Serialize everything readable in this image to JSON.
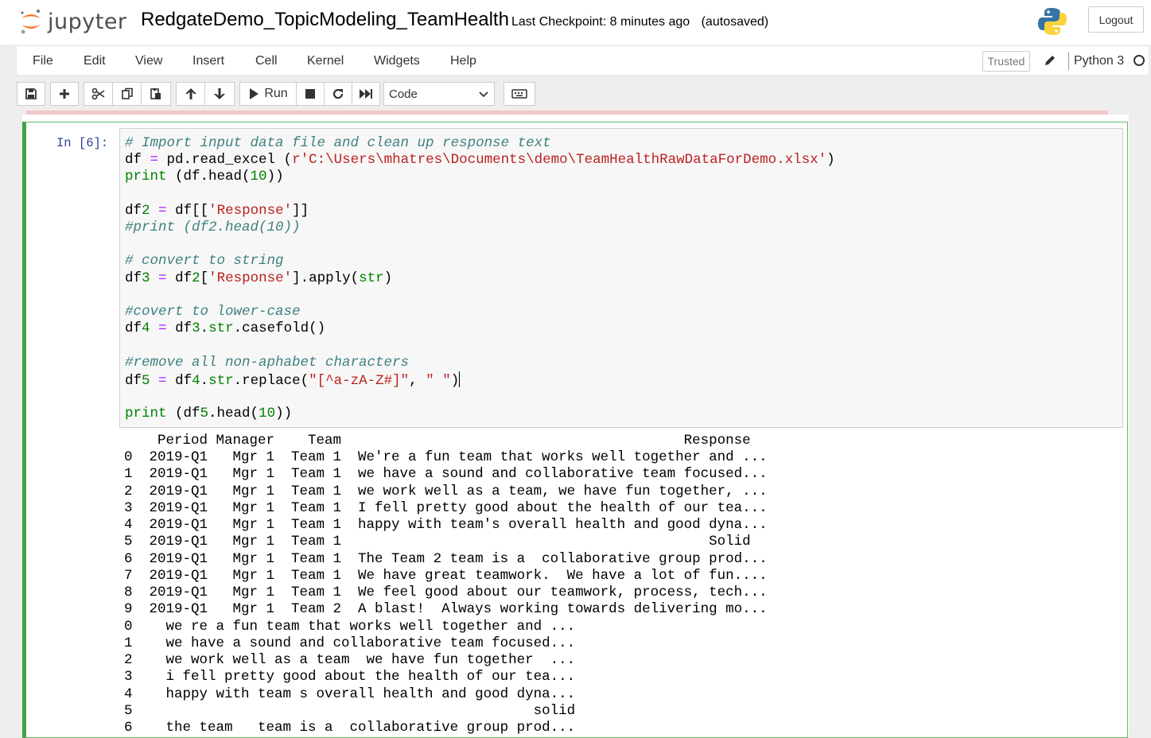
{
  "header": {
    "logo_text": "jupyter",
    "notebook_title": "RedgateDemo_TopicModeling_TeamHealth",
    "checkpoint": "Last Checkpoint: 8 minutes ago",
    "autosave_status": "(autosaved)",
    "logout_label": "Logout"
  },
  "menubar": {
    "items": [
      "File",
      "Edit",
      "View",
      "Insert",
      "Cell",
      "Kernel",
      "Widgets",
      "Help"
    ],
    "trusted_label": "Trusted",
    "kernel_name": "Python 3"
  },
  "toolbar": {
    "run_label": "Run",
    "cell_type": "Code",
    "icons": [
      "save-icon",
      "plus-icon",
      "cut-icon",
      "copy-icon",
      "paste-icon",
      "arrow-up-icon",
      "arrow-down-icon",
      "play-icon",
      "stop-icon",
      "restart-icon",
      "fast-forward-icon",
      "keyboard-icon"
    ]
  },
  "cell": {
    "prompt": "In [6]:",
    "code_lines": [
      "# Import input data file and clean up response text",
      "df = pd.read_excel (r'C:\\Users\\mhatres\\Documents\\demo\\TeamHealthRawDataForDemo.xlsx')",
      "print (df.head(10))",
      "",
      "df2 = df[['Response']]",
      "#print (df2.head(10))",
      "",
      "# convert to string",
      "df3 = df2['Response'].apply(str)",
      "",
      "#covert to lower-case",
      "df4 = df3.str.casefold()",
      "",
      "#remove all non-aphabet characters",
      "df5 = df4.str.replace(\"[^a-zA-Z#]\", \" \")",
      "",
      "print (df5.head(10))"
    ],
    "output_lines": [
      "    Period Manager    Team                                         Response",
      "0  2019-Q1   Mgr 1  Team 1  We're a fun team that works well together and ...",
      "1  2019-Q1   Mgr 1  Team 1  we have a sound and collaborative team focused...",
      "2  2019-Q1   Mgr 1  Team 1  we work well as a team, we have fun together, ...",
      "3  2019-Q1   Mgr 1  Team 1  I fell pretty good about the health of our tea...",
      "4  2019-Q1   Mgr 1  Team 1  happy with team's overall health and good dyna...",
      "5  2019-Q1   Mgr 1  Team 1                                            Solid",
      "6  2019-Q1   Mgr 1  Team 1  The Team 2 team is a  collaborative group prod...",
      "7  2019-Q1   Mgr 1  Team 1  We have great teamwork.  We have a lot of fun....",
      "8  2019-Q1   Mgr 1  Team 1  We feel good about our teamwork, process, tech...",
      "9  2019-Q1   Mgr 1  Team 2  A blast!  Always working towards delivering mo...",
      "0    we re a fun team that works well together and ...",
      "1    we have a sound and collaborative team focused...",
      "2    we work well as a team  we have fun together  ...",
      "3    i fell pretty good about the health of our tea...",
      "4    happy with team s overall health and good dyna...",
      "5                                                solid",
      "6    the team   team is a  collaborative group prod..."
    ]
  },
  "colors": {
    "cell_border": "#42a047",
    "prompt": "#303f9f",
    "comment": "#408080",
    "string": "#ba2121",
    "keyword": "#008000",
    "operator": "#aa22ff"
  }
}
